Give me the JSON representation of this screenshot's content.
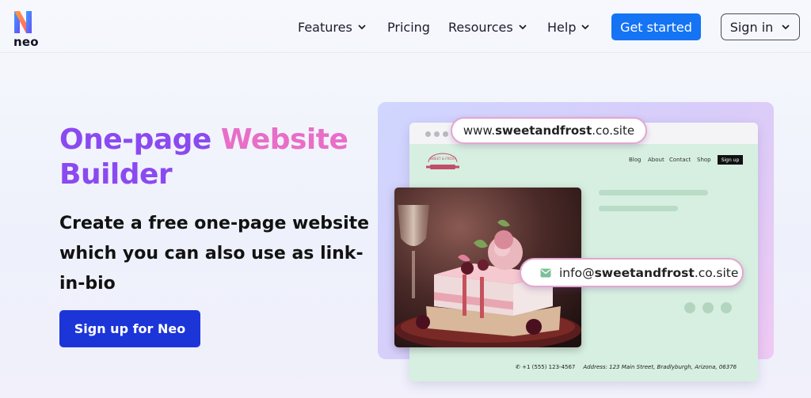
{
  "header": {
    "logo_text": "neo",
    "nav": [
      {
        "label": "Features",
        "dropdown": true
      },
      {
        "label": "Pricing",
        "dropdown": false
      },
      {
        "label": "Resources",
        "dropdown": true
      },
      {
        "label": "Help",
        "dropdown": true
      }
    ],
    "get_started_label": "Get started",
    "sign_in_label": "Sign in"
  },
  "hero": {
    "title_part1": "One-page",
    "title_part2": "Website",
    "title_part3": "Builder",
    "subtitle": "Create a free one-page website which you can also use as link-in-bio",
    "cta_label": "Sign up for Neo"
  },
  "preview": {
    "url_prefix": "www.",
    "url_domain": "sweetandfrost",
    "url_suffix": ".co.site",
    "logo_text": "SWEET & FROST",
    "site_nav": [
      "Blog",
      "About",
      "Contact",
      "Shop"
    ],
    "site_signup": "Sign up",
    "email_prefix": "info@",
    "email_domain": "sweetandfrost",
    "email_suffix": ".co.site",
    "phone": "+1 (555) 123-4567",
    "address": "Address: 123 Main Street, Bradlyburgh, Arizona, 06376"
  },
  "colors": {
    "brand_blue": "#1474f4",
    "cta_blue": "#1c35d9",
    "title_purple": "#8b4af0",
    "title_pink": "#e86ec8"
  }
}
